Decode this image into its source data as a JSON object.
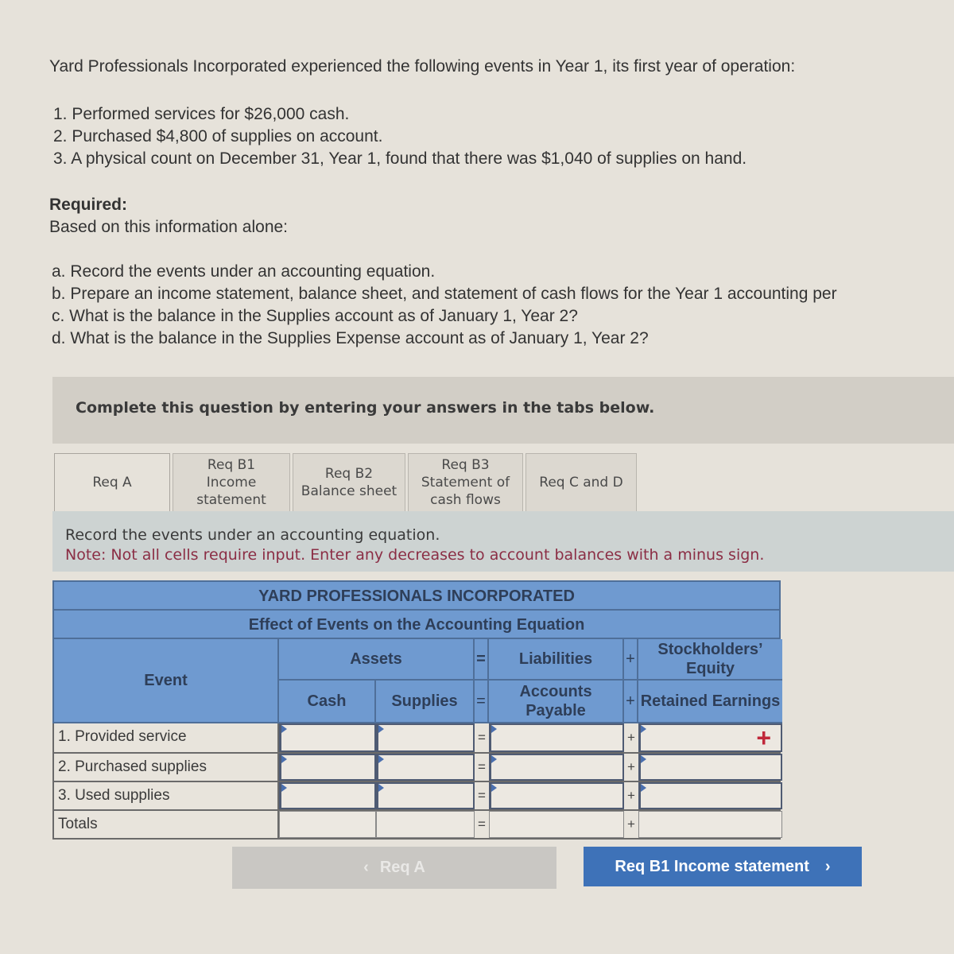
{
  "problem": {
    "intro": "Yard Professionals Incorporated experienced the following events in Year 1, its first year of operation:",
    "events": [
      "1. Performed services for $26,000 cash.",
      "2. Purchased $4,800 of supplies on account.",
      "3. A physical count on December 31, Year 1, found that there was $1,040 of supplies on hand."
    ],
    "required_label": "Required:",
    "required_sub": "Based on this information alone:",
    "requirements": [
      "a. Record the events under an accounting equation.",
      "b. Prepare an income statement, balance sheet, and statement of cash flows for the Year 1 accounting per",
      "c. What is the balance in the Supplies account as of January 1, Year 2?",
      "d. What is the balance in the Supplies Expense account as of January 1, Year 2?"
    ]
  },
  "instructions": "Complete this question by entering your answers in the tabs below.",
  "tabs": [
    {
      "label": "Req A",
      "active": true
    },
    {
      "label": "Req B1 Income statement",
      "lines": [
        "Req B1",
        "Income",
        "statement"
      ]
    },
    {
      "label": "Req B2 Balance sheet",
      "lines": [
        "Req B2",
        "Balance sheet"
      ]
    },
    {
      "label": "Req B3 Statement of cash flows",
      "lines": [
        "Req B3",
        "Statement of",
        "cash flows"
      ]
    },
    {
      "label": "Req C and D"
    }
  ],
  "note": {
    "line1": "Record the events under an accounting equation.",
    "line2": "Note: Not all cells require input. Enter any decreases to account balances with a minus sign."
  },
  "sheet": {
    "company": "YARD PROFESSIONALS INCORPORATED",
    "title": "Effect of Events on the Accounting Equation",
    "headers": {
      "event": "Event",
      "assets": "Assets",
      "equals": "=",
      "liabilities": "Liabilities",
      "plus": "+",
      "equity": "Stockholders’ Equity",
      "cash": "Cash",
      "supplies": "Supplies",
      "accounts_payable": "Accounts Payable",
      "retained_earnings": "Retained Earnings"
    },
    "rows": [
      {
        "event": "1. Provided service",
        "cash": "",
        "supplies": "",
        "accounts_payable": "",
        "retained_earnings": ""
      },
      {
        "event": "2. Purchased supplies",
        "cash": "",
        "supplies": "",
        "accounts_payable": "",
        "retained_earnings": ""
      },
      {
        "event": "3. Used supplies",
        "cash": "",
        "supplies": "",
        "accounts_payable": "",
        "retained_earnings": ""
      },
      {
        "event": "Totals",
        "cash": "",
        "supplies": "",
        "accounts_payable": "",
        "retained_earnings": ""
      }
    ],
    "add_icon": "+"
  },
  "nav": {
    "prev_label": "Req A",
    "prev_icon": "‹",
    "next_label": "Req B1 Income statement",
    "next_icon": "›"
  },
  "colors": {
    "header_blue": "#6f9ad0",
    "next_button": "#3e72b8",
    "note_red": "#8b2e45",
    "add_red": "#c0283a"
  }
}
